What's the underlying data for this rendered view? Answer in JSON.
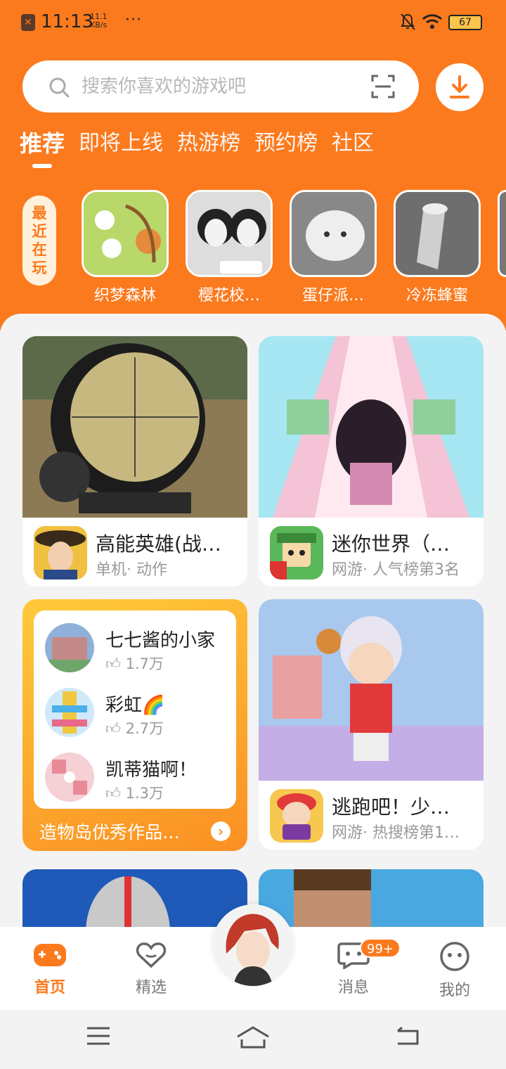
{
  "status_bar": {
    "time": "11:13",
    "speed_value": "11.1",
    "speed_unit": "KB/s",
    "more": "···",
    "battery": "67"
  },
  "search": {
    "placeholder": "搜索你喜欢的游戏吧"
  },
  "tabs": [
    {
      "label": "推荐",
      "active": true
    },
    {
      "label": "即将上线"
    },
    {
      "label": "热游榜"
    },
    {
      "label": "预约榜"
    },
    {
      "label": "社区"
    }
  ],
  "recent": {
    "label": "最近在玩",
    "items": [
      {
        "name": "织梦森林"
      },
      {
        "name": "樱花校…"
      },
      {
        "name": "蛋仔派…"
      },
      {
        "name": "冷冻蜂蜜"
      }
    ]
  },
  "cards": [
    {
      "title": "高能英雄(战…",
      "sub": "单机· 动作"
    },
    {
      "title": "迷你世界（…",
      "sub": "网游· 人气榜第3名"
    },
    {
      "title": "逃跑吧！少…",
      "sub": "网游· 热搜榜第1…"
    }
  ],
  "ugc": {
    "items": [
      {
        "title": "七七酱的小家",
        "likes": "1.7万"
      },
      {
        "title": "彩虹🌈",
        "likes": "2.7万"
      },
      {
        "title": "凯蒂猫啊！",
        "likes": "1.3万"
      }
    ],
    "footer": "造物岛优秀作品…"
  },
  "bottom_nav": {
    "home": "首页",
    "featured": "精选",
    "messages": "消息",
    "messages_badge": "99+",
    "me": "我的"
  },
  "colors": {
    "brand": "#fb7a1e"
  }
}
